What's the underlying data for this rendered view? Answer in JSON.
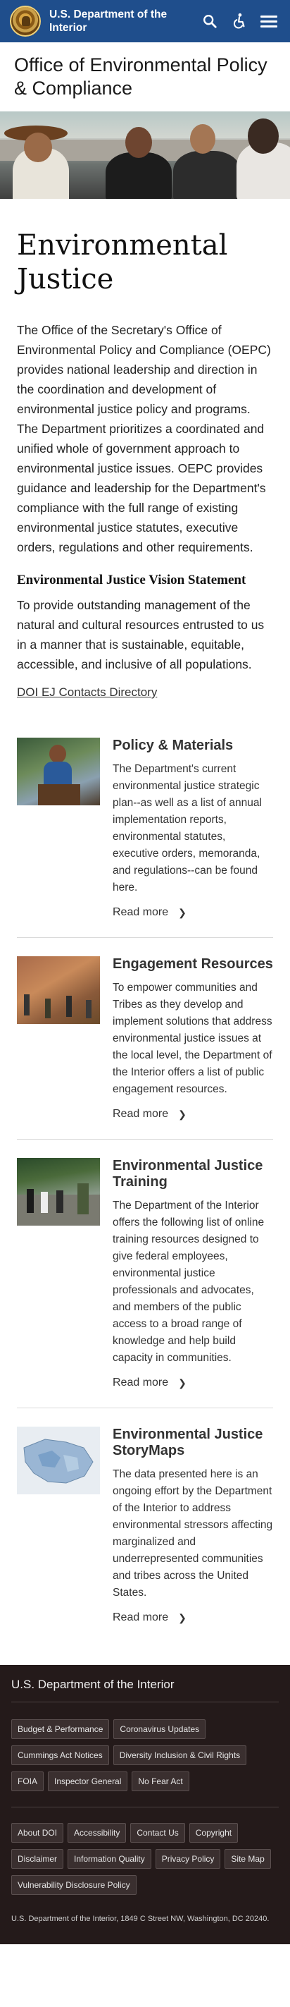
{
  "header": {
    "brand_line1": "U.S. Department of the",
    "brand_line2": "Interior"
  },
  "office_title": "Office of Environmental Policy & Compliance",
  "page_title": "Environmental Justice",
  "intro": "The Office of the Secretary's Office of Environmental Policy and Compliance (OEPC) provides national leadership and direction in the coordination and development of environmental justice policy and programs. The Department prioritizes a coordinated and unified whole of government approach to environmental justice issues. OEPC provides guidance and leadership for the Department's compliance with the full range of existing environmental justice statutes, executive orders, regulations and other requirements.",
  "vision": {
    "heading": "Environmental Justice Vision Statement",
    "text": "To provide outstanding management of the natural and cultural resources entrusted to us in a manner that is sustainable, equitable, accessible, and inclusive of all populations."
  },
  "contacts_link": "DOI EJ Contacts Directory",
  "cards": [
    {
      "title": "Policy & Materials",
      "desc": "The Department's current environmental justice strategic plan--as well as a list of annual implementation reports, environmental statutes, executive orders, memoranda, and regulations--can be found here.",
      "link": "Read more"
    },
    {
      "title": "Engagement Resources",
      "desc": "To empower communities and Tribes as they develop and implement solutions that address environmental justice issues at the local level, the Department of the Interior offers a list of public engagement resources.",
      "link": "Read more"
    },
    {
      "title": "Environmental Justice Training",
      "desc": "The Department of the Interior offers the following list of online training resources designed to give federal employees, environmental justice professionals and advocates, and members of the public access to a broad range of knowledge and help build capacity in communities.",
      "link": "Read more"
    },
    {
      "title": "Environmental Justice StoryMaps",
      "desc": "The data presented here is an ongoing effort by the Department of the Interior to address environmental stressors affecting marginalized and underrepresented communities and tribes across the United States.",
      "link": "Read more"
    }
  ],
  "footer": {
    "title": "U.S. Department of the Interior",
    "primary_links": [
      "Budget & Performance",
      "Coronavirus Updates",
      "Cummings Act Notices",
      "Diversity Inclusion & Civil Rights",
      "FOIA",
      "Inspector General",
      "No Fear Act"
    ],
    "secondary_links": [
      "About DOI",
      "Accessibility",
      "Contact Us",
      "Copyright",
      "Disclaimer",
      "Information Quality",
      "Privacy Policy",
      "Site Map",
      "Vulnerability Disclosure Policy"
    ],
    "address": "U.S. Department of the Interior, 1849 C Street NW, Washington, DC 20240."
  },
  "colors": {
    "header_bg": "#1f4e8c",
    "footer_bg": "#241a1a"
  },
  "icons": [
    "doi-seal-logo",
    "search-icon",
    "accessibility-icon",
    "menu-icon",
    "chevron-right-icon"
  ]
}
